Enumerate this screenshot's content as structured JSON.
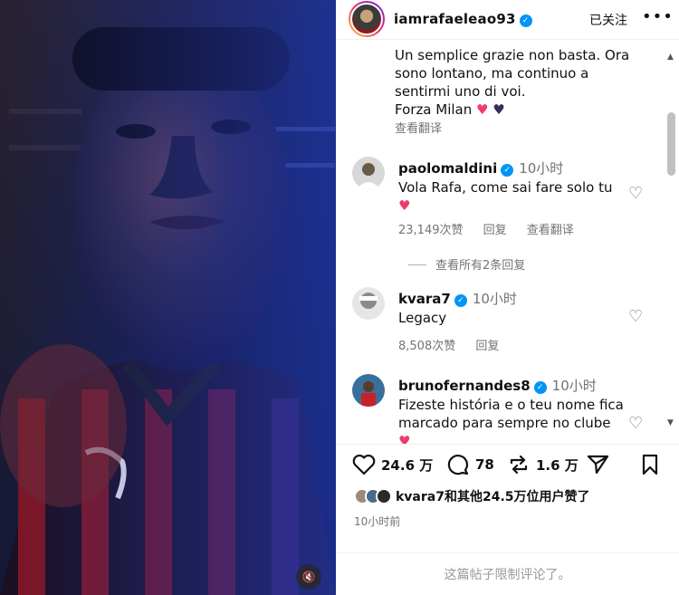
{
  "header": {
    "username": "iamrafaeleao93",
    "follow_label": "已关注",
    "more_label": "•••"
  },
  "caption": {
    "lines": [
      "Un semplice grazie non basta. Ora",
      "sono lontano, ma continuo a",
      "sentirmi uno di voi.",
      "Forza Milan"
    ],
    "translate_label": "查看翻译"
  },
  "comments": [
    {
      "username": "paolomaldini",
      "time": "10小时",
      "text": "Vola Rafa, come sai fare solo tu",
      "likes": "23,149次赞",
      "reply_label": "回复",
      "translate_label": "查看翻译"
    },
    {
      "username": "kvara7",
      "time": "10小时",
      "text": "Legacy",
      "likes": "8,508次赞",
      "reply_label": "回复"
    },
    {
      "username": "brunofernandes8",
      "time": "10小时",
      "text": "Fizeste história e o teu nome fica marcado para sempre no clube"
    }
  ],
  "view_replies_label": "查看所有2条回复",
  "actions": {
    "likes": "24.6 万",
    "comments": "78",
    "reposts": "1.6 万"
  },
  "liked_by": {
    "text": "kvara7和其他24.5万位用户赞了"
  },
  "time_ago": "10小时前",
  "comments_limited": "这篇帖子限制评论了。",
  "icons": {
    "heart": "heart-icon",
    "comment": "comment-icon",
    "repost": "repost-icon",
    "share": "share-icon",
    "bookmark": "bookmark-icon",
    "mute": "mute-icon",
    "verified": "verified-icon"
  },
  "colors": {
    "verified": "#0095f6",
    "heart_pink": "#f03a6d",
    "muted_text": "#737373"
  }
}
